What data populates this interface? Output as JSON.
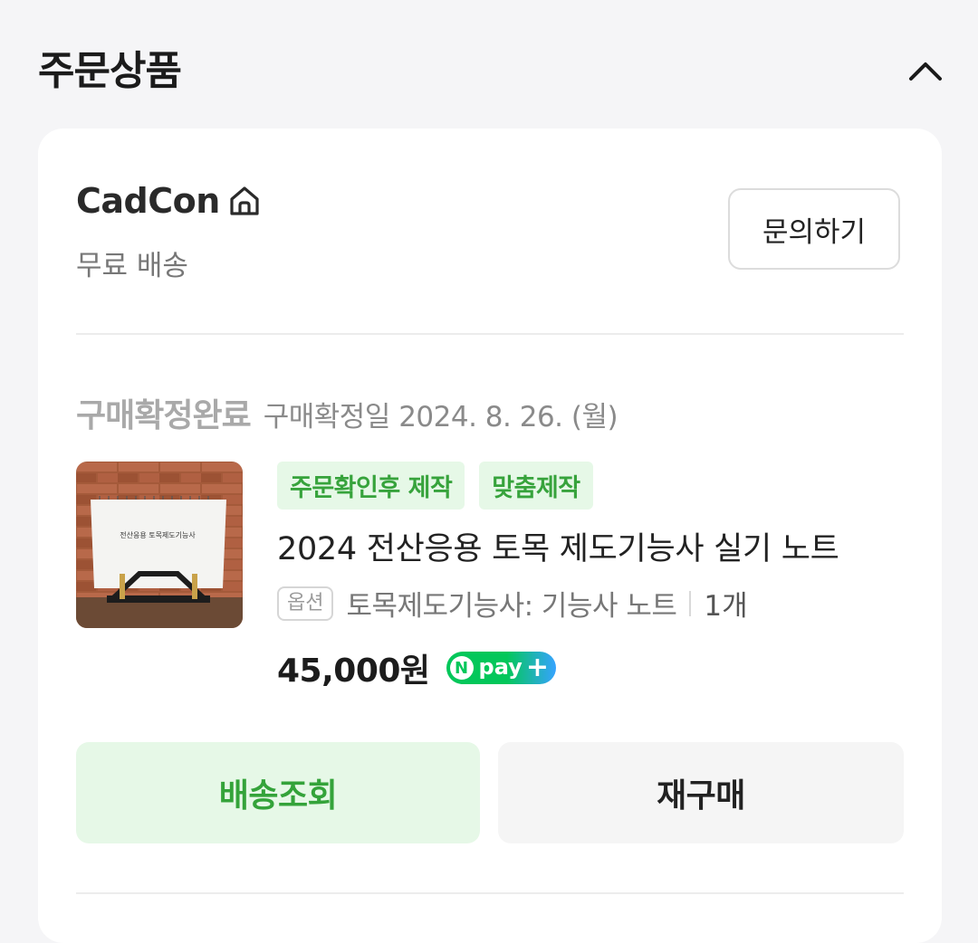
{
  "section": {
    "title": "주문상품"
  },
  "seller": {
    "name": "CadCon",
    "shipping": "무료 배송",
    "inquiry_label": "문의하기"
  },
  "order": {
    "status": "구매확정완료",
    "confirm_date": "구매확정일 2024. 8. 26. (월)",
    "tags": [
      "주문확인후 제작",
      "맞춤제작"
    ],
    "product_name": "2024 전산응용 토목 제도기능사 실기 노트",
    "option_badge": "옵션",
    "option_value": "토목제도기능사: 기능사 노트",
    "quantity": "1개",
    "price": "45,000원",
    "pay_badge": {
      "n": "N",
      "text": "pay",
      "plus": "+"
    },
    "thumbnail_caption": "전산응용 토목제도기능사"
  },
  "actions": {
    "track_label": "배송조회",
    "rebuy_label": "재구매"
  },
  "colors": {
    "accent_green": "#37a33c",
    "tag_bg": "#e6f8e7",
    "npay_green": "#03c75a",
    "npay_blue": "#36a3ff"
  },
  "icons": {
    "collapse": "chevron-up-icon",
    "store": "home-icon"
  }
}
